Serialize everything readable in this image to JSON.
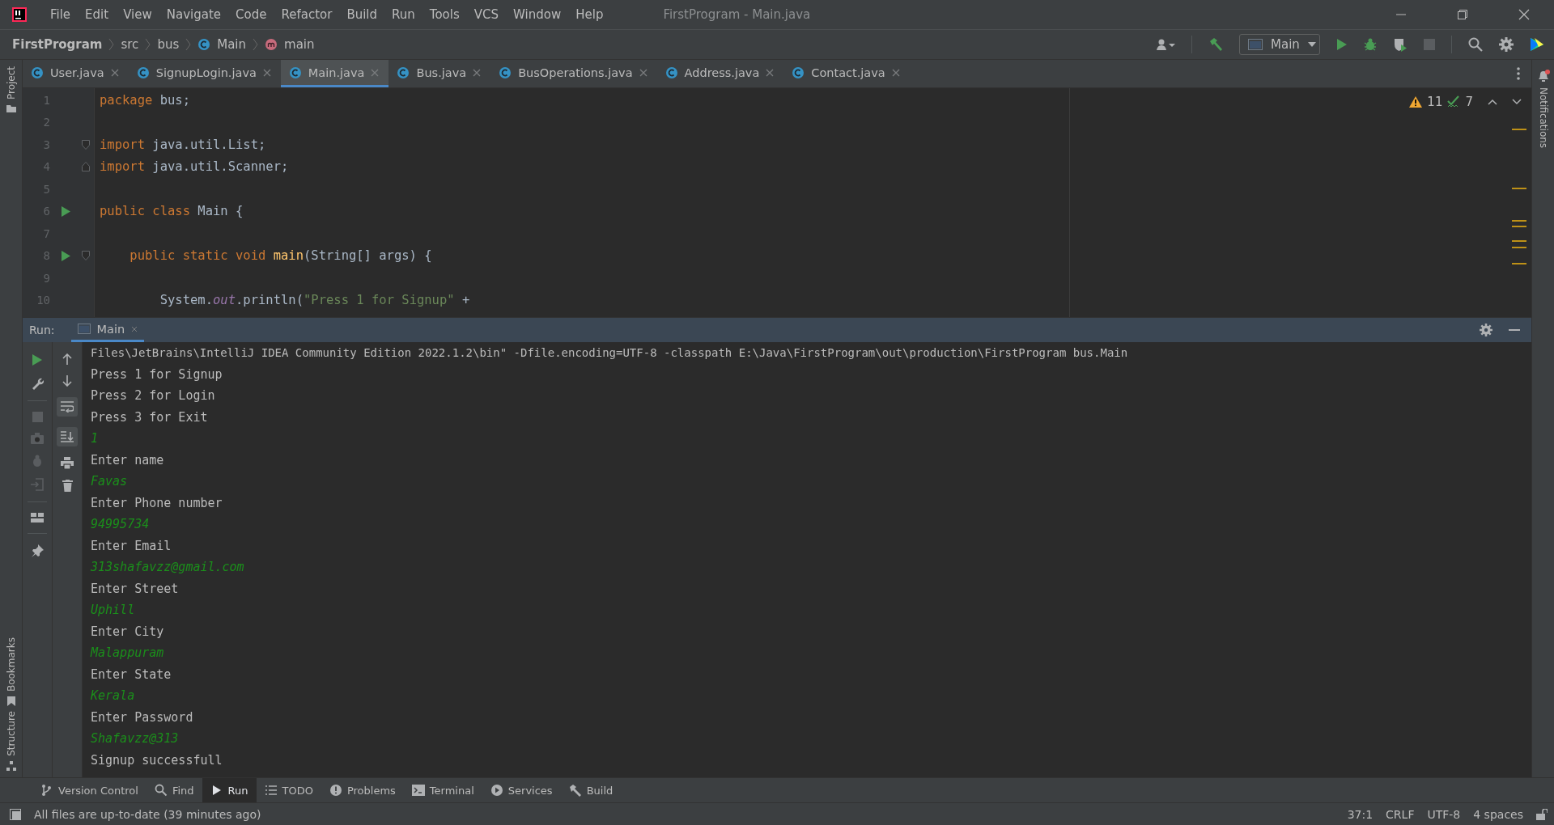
{
  "window": {
    "title": "FirstProgram - Main.java"
  },
  "menu": [
    "File",
    "Edit",
    "View",
    "Navigate",
    "Code",
    "Refactor",
    "Build",
    "Run",
    "Tools",
    "VCS",
    "Window",
    "Help"
  ],
  "breadcrumbs": [
    {
      "label": "FirstProgram",
      "kind": "project"
    },
    {
      "label": "src",
      "kind": "folder"
    },
    {
      "label": "bus",
      "kind": "folder"
    },
    {
      "label": "Main",
      "kind": "class"
    },
    {
      "label": "main",
      "kind": "method"
    }
  ],
  "toolbar": {
    "run_config": "Main"
  },
  "tabs": [
    {
      "label": "User.java",
      "selected": false
    },
    {
      "label": "SignupLogin.java",
      "selected": false
    },
    {
      "label": "Main.java",
      "selected": true
    },
    {
      "label": "Bus.java",
      "selected": false
    },
    {
      "label": "BusOperations.java",
      "selected": false
    },
    {
      "label": "Address.java",
      "selected": false
    },
    {
      "label": "Contact.java",
      "selected": false
    }
  ],
  "left_stripe": {
    "top": "Project",
    "bottom": [
      "Bookmarks",
      "Structure"
    ]
  },
  "right_stripe": [
    "Notifications"
  ],
  "editor": {
    "warnings": "11",
    "typos": "7",
    "lines": [
      {
        "number": "1",
        "tokens": [
          {
            "t": "package ",
            "kind": "keyword"
          },
          {
            "t": "bus;",
            "kind": "plain"
          }
        ]
      },
      {
        "number": "2"
      },
      {
        "number": "3",
        "fold_open": true,
        "tokens": [
          {
            "t": "import ",
            "kind": "keyword"
          },
          {
            "t": "java.util.List;",
            "kind": "plain"
          }
        ]
      },
      {
        "number": "4",
        "fold_close": true,
        "tokens": [
          {
            "t": "import ",
            "kind": "keyword"
          },
          {
            "t": "java.util.Scanner;",
            "kind": "plain"
          }
        ]
      },
      {
        "number": "5"
      },
      {
        "number": "6",
        "run": true,
        "tokens": [
          {
            "t": "public class ",
            "kind": "keyword"
          },
          {
            "t": "Main {",
            "kind": "plain"
          }
        ]
      },
      {
        "number": "7"
      },
      {
        "number": "8",
        "run": true,
        "fold_open": true,
        "tokens": [
          {
            "t": "    public static void ",
            "kind": "keyword"
          },
          {
            "t": "main",
            "kind": "function"
          },
          {
            "t": "(String[] args) {",
            "kind": "plain"
          }
        ]
      },
      {
        "number": "9"
      },
      {
        "number": "10",
        "tokens": [
          {
            "t": "        System.",
            "kind": "plain"
          },
          {
            "t": "out",
            "kind": "field"
          },
          {
            "t": ".println(",
            "kind": "plain"
          },
          {
            "t": "\"Press 1 for Signup\"",
            "kind": "string"
          },
          {
            "t": " +",
            "kind": "plain"
          }
        ]
      }
    ]
  },
  "run_panel": {
    "label": "Run:",
    "tab": "Main",
    "console": [
      {
        "text": "Files\\JetBrains\\IntelliJ IDEA Community Edition 2022.1.2\\bin\" -Dfile.encoding=UTF-8 -classpath E:\\Java\\FirstProgram\\out\\production\\FirstProgram bus.Main",
        "kind": "command"
      },
      {
        "text": "Press 1 for Signup",
        "kind": "output"
      },
      {
        "text": "Press 2 for Login",
        "kind": "output"
      },
      {
        "text": "Press 3 for Exit",
        "kind": "output"
      },
      {
        "text": "1",
        "kind": "input"
      },
      {
        "text": "Enter name",
        "kind": "output"
      },
      {
        "text": "Favas",
        "kind": "input"
      },
      {
        "text": "Enter Phone number",
        "kind": "output"
      },
      {
        "text": "94995734",
        "kind": "input"
      },
      {
        "text": "Enter Email",
        "kind": "output"
      },
      {
        "text": "313shafavzz@gmail.com",
        "kind": "input"
      },
      {
        "text": "Enter Street",
        "kind": "output"
      },
      {
        "text": "Uphill",
        "kind": "input"
      },
      {
        "text": "Enter City",
        "kind": "output"
      },
      {
        "text": "Malappuram",
        "kind": "input"
      },
      {
        "text": "Enter State",
        "kind": "output"
      },
      {
        "text": "Kerala",
        "kind": "input"
      },
      {
        "text": "Enter Password",
        "kind": "output"
      },
      {
        "text": "Shafavzz@313",
        "kind": "input"
      },
      {
        "text": "Signup successfull",
        "kind": "output"
      }
    ]
  },
  "tool_tabs": [
    {
      "label": "Version Control",
      "selected": false
    },
    {
      "label": "Find",
      "selected": false
    },
    {
      "label": "Run",
      "selected": true
    },
    {
      "label": "TODO",
      "selected": false
    },
    {
      "label": "Problems",
      "selected": false
    },
    {
      "label": "Terminal",
      "selected": false
    },
    {
      "label": "Services",
      "selected": false
    },
    {
      "label": "Build",
      "selected": false
    }
  ],
  "status_bar": {
    "message": "All files are up-to-date (39 minutes ago)",
    "items": [
      "37:1",
      "CRLF",
      "UTF-8",
      "4 spaces"
    ]
  }
}
